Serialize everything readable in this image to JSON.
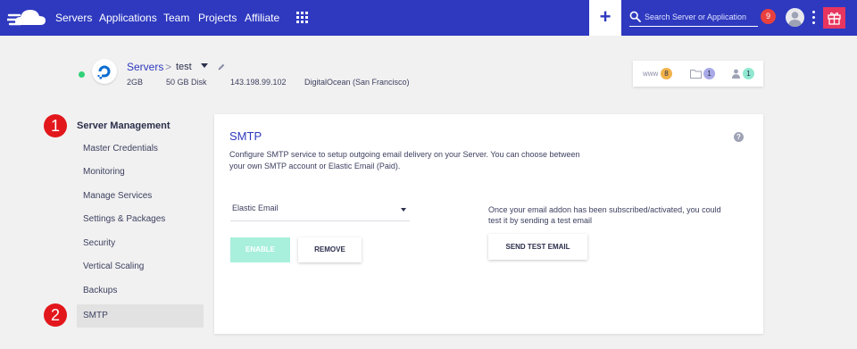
{
  "nav": {
    "items": [
      "Servers",
      "Applications",
      "Team",
      "Projects",
      "Affiliate"
    ],
    "apps_icon": "grid-icon",
    "add_icon": "plus-icon",
    "add_label": "+",
    "search_placeholder": "Search Server or Application",
    "notifications_count": "9",
    "gift_icon": "gift-icon"
  },
  "server": {
    "breadcrumb_root": "Servers",
    "breadcrumb_sep": ">",
    "name": "test",
    "status_color": "#31d17a",
    "ram": "2GB",
    "disk": "50 GB Disk",
    "ip": "143.198.99.102",
    "provider": "DigitalOcean (San Francisco)"
  },
  "stats": {
    "www_label": "www",
    "www_count": "8",
    "files_icon": "folder-icon",
    "files_count": "1",
    "users_icon": "user-icon",
    "users_count": "1"
  },
  "annotations": {
    "step1": "1",
    "step2": "2"
  },
  "sidebar": {
    "title": "Server Management",
    "items": [
      {
        "label": "Master Credentials"
      },
      {
        "label": "Monitoring"
      },
      {
        "label": "Manage Services"
      },
      {
        "label": "Settings & Packages"
      },
      {
        "label": "Security"
      },
      {
        "label": "Vertical Scaling"
      },
      {
        "label": "Backups"
      },
      {
        "label": "SMTP"
      }
    ],
    "active_index": 7
  },
  "smtp": {
    "title": "SMTP",
    "help_label": "?",
    "description": "Configure SMTP service to setup outgoing email delivery on your Server. You can choose between your own SMTP account or Elastic Email (Paid).",
    "select_value": "Elastic Email",
    "enable_label": "ENABLE",
    "remove_label": "REMOVE",
    "test_note": "Once your email addon has been subscribed/activated, you could test it by sending a test email",
    "send_test_label": "SEND TEST EMAIL"
  },
  "colors": {
    "nav_bg": "#2e39bf",
    "accent": "#2e39bf",
    "badge_red": "#e8403e",
    "enable_disabled": "#a8f0dc",
    "gift": "#e8355f"
  }
}
